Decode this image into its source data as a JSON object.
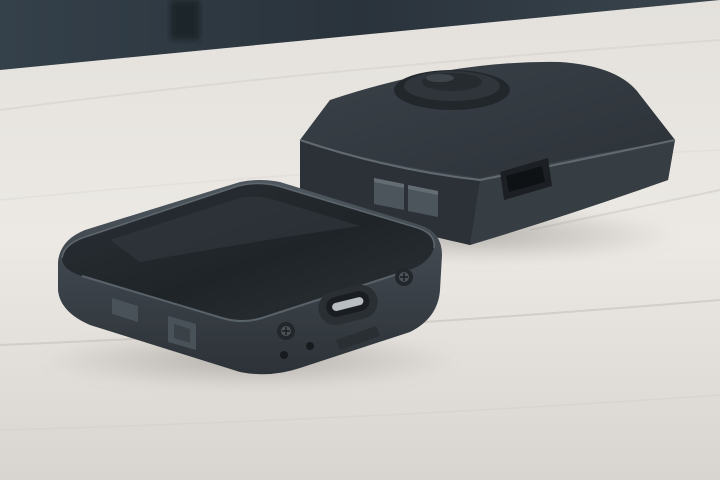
{
  "photo": {
    "subject": "two-dark-grey-electronic-devices-on-wooden-table",
    "colors": {
      "table_light": "#ebe8e4",
      "table_mid": "#d7d3ce",
      "table_shadow": "#bdb8b2",
      "background_dark": "#2f3941",
      "device_body": "#3b4249",
      "device_top": "#23282d",
      "device_edge": "#555d65",
      "device_highlight": "#6b737b",
      "port_metal": "#b9bec2"
    },
    "icons": {
      "usb_c_port": "usb-c-port-icon",
      "screw": "screw-icon",
      "button": "side-button-icon",
      "mount": "quarter-turn-mount-icon"
    }
  }
}
